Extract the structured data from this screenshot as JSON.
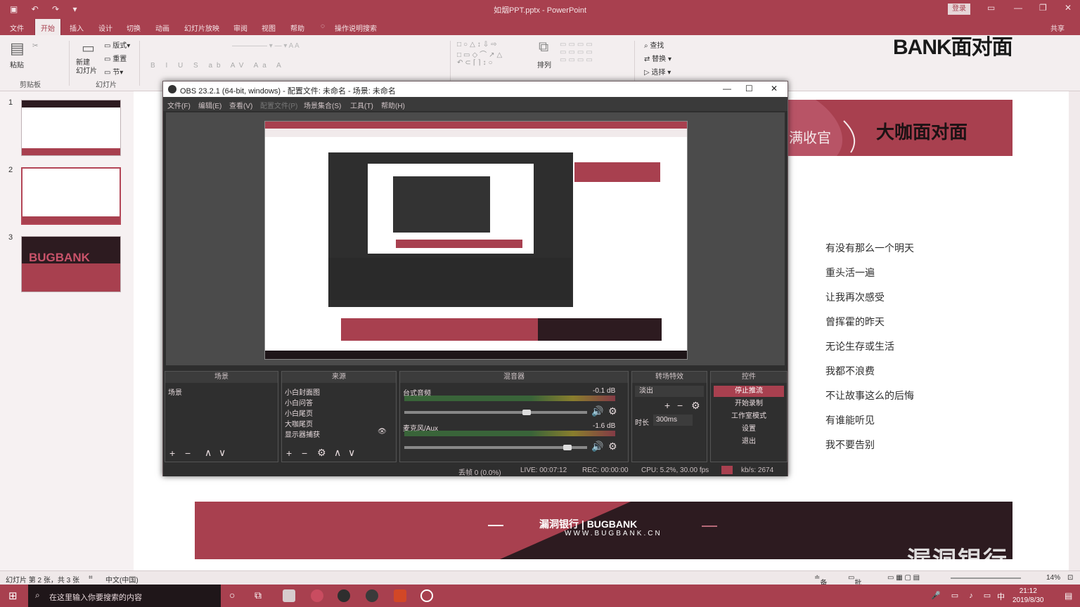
{
  "ppt": {
    "title": "如烟PPT.pptx - PowerPoint",
    "login": "登录",
    "share": "共享",
    "tabs": [
      "文件",
      "开始",
      "插入",
      "设计",
      "切换",
      "动画",
      "幻灯片放映",
      "审阅",
      "视图",
      "帮助",
      "操作说明搜索"
    ],
    "active_tab": "开始",
    "ribbon": {
      "paste": "粘贴",
      "clipboard": "剪贴板",
      "new_slide": "新建\n幻灯片",
      "layout": "版式",
      "reset": "重置",
      "section": "节",
      "slides_group": "幻灯片",
      "arrange": "排列",
      "find": "查找",
      "replace": "替换",
      "select": "选择"
    },
    "thumbs": [
      "1",
      "2",
      "3"
    ],
    "thumb3_text": "BUGBANK"
  },
  "slide": {
    "banner_left": "满收官",
    "banner_right": "大咖面对面",
    "lyrics": [
      "有没有那么一个明天",
      "重头活一遍",
      "让我再次感受",
      "曾挥霍的昨天",
      "无论生存或生活",
      "我都不浪费",
      "不让故事这么的后悔",
      "有谁能听见",
      "我不要告别"
    ],
    "footer_brand": "漏洞银行 | BUGBANK",
    "footer_url": "WWW.BUGBANK.CN",
    "watermark": "漏洞银行",
    "top_logo": "BANK面对面"
  },
  "statusbar": {
    "slide_info": "幻灯片 第 2 张，共 3 张",
    "lang": "中文(中国)",
    "notes": "备注",
    "comments": "批注",
    "zoom": "14%"
  },
  "taskbar": {
    "search_placeholder": "在这里输入你要搜索的内容",
    "ime": "中",
    "time": "21:12",
    "date": "2019/8/30"
  },
  "obs": {
    "title": "OBS 23.2.1 (64-bit, windows) - 配置文件: 未命名 - 场景: 未命名",
    "menu": [
      "文件(F)",
      "编辑(E)",
      "查看(V)",
      "配置文件(P)",
      "场景集合(S)",
      "工具(T)",
      "帮助(H)"
    ],
    "docks": {
      "scenes_title": "场景",
      "scene_item": "场景",
      "sources_title": "来源",
      "sources": [
        "小白封面图",
        "小白问答",
        "小白尾页",
        "大咖尾页",
        "显示器捕获"
      ],
      "mixer_title": "混音器",
      "mixer": [
        {
          "name": "台式音频",
          "db": "-0.1 dB"
        },
        {
          "name": "麦克风/Aux",
          "db": "-1.6 dB"
        }
      ],
      "transitions_title": "转场特效",
      "transition": "淡出",
      "duration_label": "时长",
      "duration": "300ms",
      "controls_title": "控件",
      "controls": [
        "停止推流",
        "开始录制",
        "工作室模式",
        "设置",
        "退出"
      ]
    },
    "status": {
      "dropped": "丢帧 0 (0.0%)",
      "live": "LIVE: 00:07:12",
      "rec": "REC: 00:00:00",
      "cpu": "CPU: 5.2%, 30.00 fps",
      "kbs": "kb/s: 2674"
    }
  }
}
